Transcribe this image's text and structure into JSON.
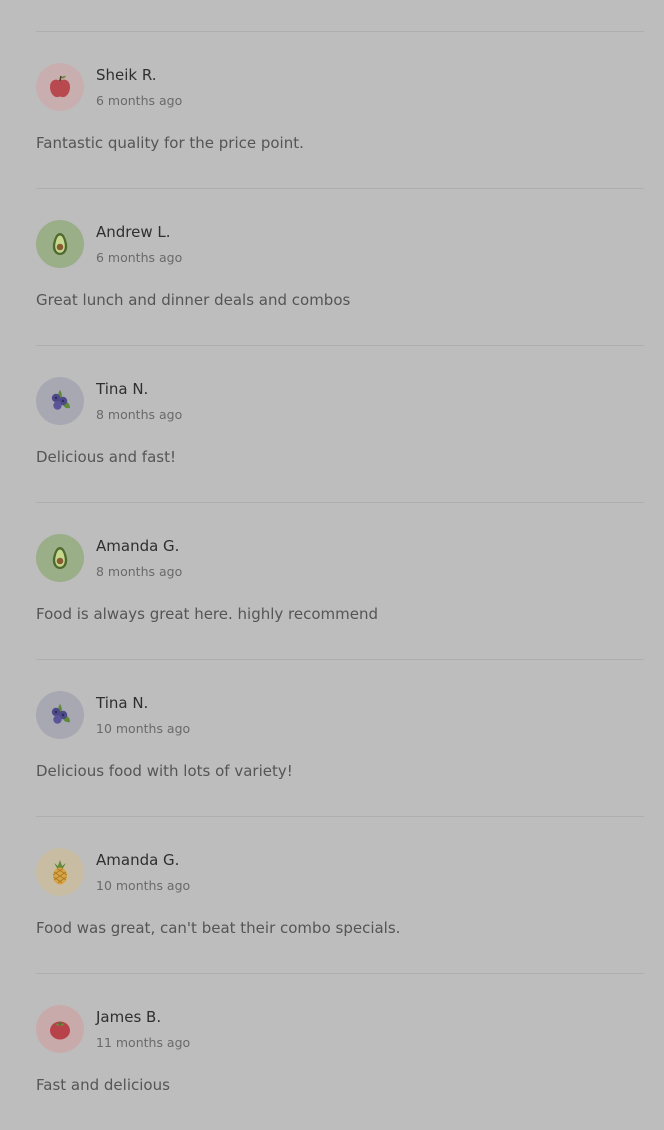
{
  "reviews": [
    {
      "name": "Sheik R.",
      "time": "6 months ago",
      "text": "Fantastic quality for the price point.",
      "avatar": "apple-icon",
      "avatar_bg": "#c9aeb0"
    },
    {
      "name": "Andrew L.",
      "time": "6 months ago",
      "text": "Great lunch and dinner deals and combos",
      "avatar": "avocado-icon",
      "avatar_bg": "#9aae88"
    },
    {
      "name": "Tina N.",
      "time": "8 months ago",
      "text": "Delicious and fast!",
      "avatar": "blueberry-icon",
      "avatar_bg": "#a8a8b2"
    },
    {
      "name": "Amanda G.",
      "time": "8 months ago",
      "text": "Food is always great here. highly recommend",
      "avatar": "avocado-icon",
      "avatar_bg": "#9aae88"
    },
    {
      "name": "Tina N.",
      "time": "10 months ago",
      "text": "Delicious food with lots of variety!",
      "avatar": "blueberry-icon",
      "avatar_bg": "#a8a8b2"
    },
    {
      "name": "Amanda G.",
      "time": "10 months ago",
      "text": "Food was great, can't beat their combo specials.",
      "avatar": "pineapple-icon",
      "avatar_bg": "#c8bca2"
    },
    {
      "name": "James B.",
      "time": "11 months ago",
      "text": "Fast and delicious",
      "avatar": "tomato-icon",
      "avatar_bg": "#c9aaaa"
    }
  ]
}
